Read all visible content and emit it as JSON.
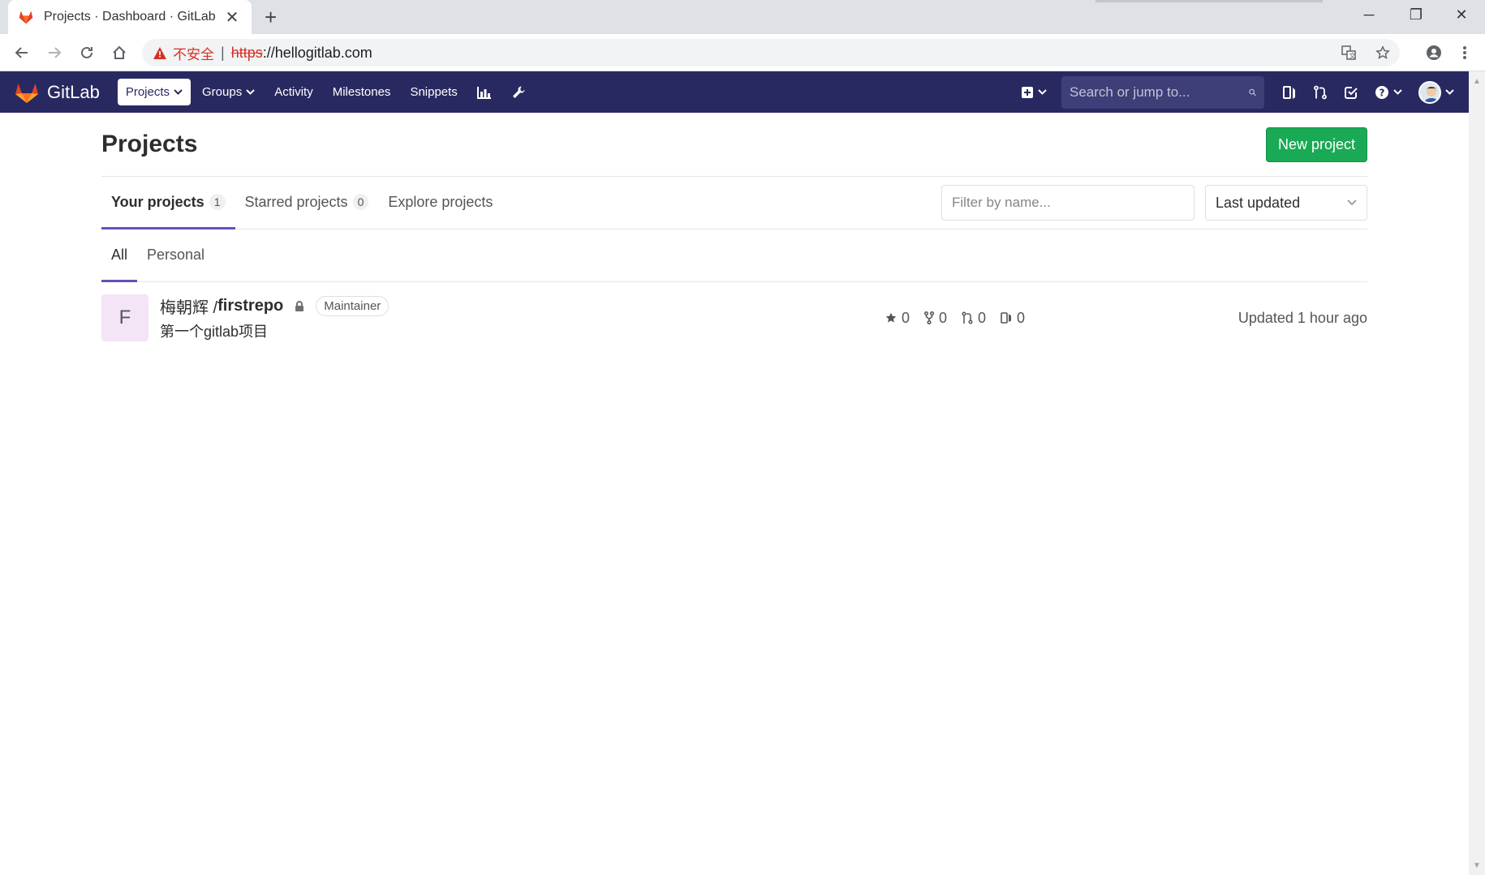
{
  "browser": {
    "tab_title": "Projects · Dashboard · GitLab",
    "tab_close": "✕",
    "new_tab": "+",
    "security_label": "不安全",
    "separator": "|",
    "url_scheme": "https",
    "url_rest": "://hellogitlab.com",
    "window_controls": [
      "─",
      "❐",
      "✕"
    ]
  },
  "navbar": {
    "brand": "GitLab",
    "items": [
      {
        "label": "Projects",
        "caret": true,
        "active": true
      },
      {
        "label": "Groups",
        "caret": true
      },
      {
        "label": "Activity"
      },
      {
        "label": "Milestones"
      },
      {
        "label": "Snippets"
      }
    ],
    "search_placeholder": "Search or jump to..."
  },
  "page": {
    "title": "Projects",
    "new_project_label": "New project",
    "tabs": [
      {
        "label": "Your projects",
        "count": "1",
        "active": true
      },
      {
        "label": "Starred projects",
        "count": "0"
      },
      {
        "label": "Explore projects"
      }
    ],
    "filter_placeholder": "Filter by name...",
    "sort_label": "Last updated",
    "subtabs": [
      {
        "label": "All",
        "active": true
      },
      {
        "label": "Personal"
      }
    ]
  },
  "projects": [
    {
      "avatar_letter": "F",
      "namespace": "梅朝辉 / ",
      "name": "firstrepo",
      "role": "Maintainer",
      "description": "第一个gitlab项目",
      "stars": "0",
      "forks": "0",
      "merge_requests": "0",
      "issues": "0",
      "updated": "Updated 1 hour ago"
    }
  ],
  "colors": {
    "navbar": "#292961",
    "accent": "#6b4fbb",
    "new_button": "#1aaa55",
    "insecure": "#d93025"
  }
}
